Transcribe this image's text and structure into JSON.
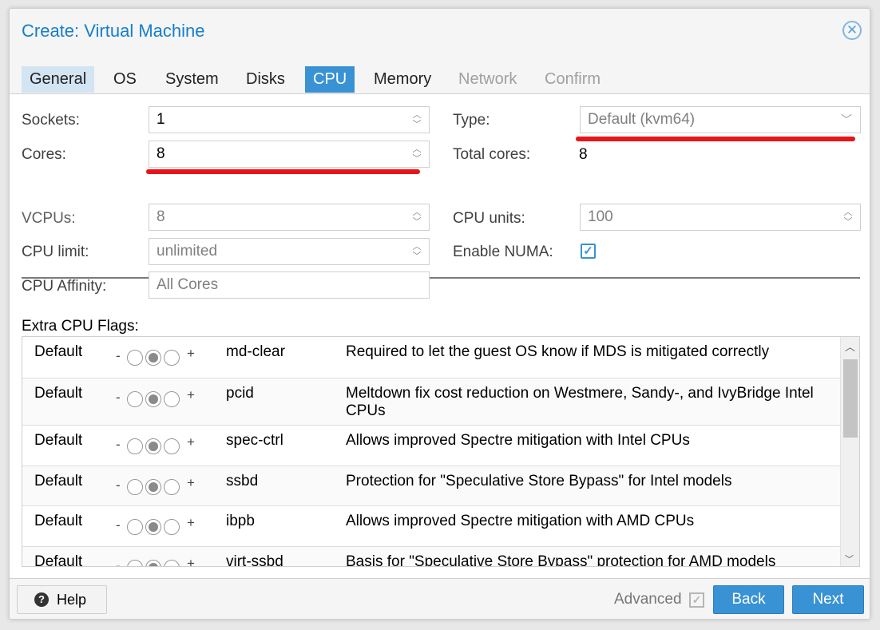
{
  "window": {
    "title": "Create: Virtual Machine"
  },
  "tabs": [
    {
      "label": "General",
      "state": "visited"
    },
    {
      "label": "OS",
      "state": "normal"
    },
    {
      "label": "System",
      "state": "normal"
    },
    {
      "label": "Disks",
      "state": "normal"
    },
    {
      "label": "CPU",
      "state": "active"
    },
    {
      "label": "Memory",
      "state": "normal"
    },
    {
      "label": "Network",
      "state": "disabled"
    },
    {
      "label": "Confirm",
      "state": "disabled"
    }
  ],
  "form": {
    "sockets": {
      "label": "Sockets:",
      "value": "1"
    },
    "cores": {
      "label": "Cores:",
      "value": "8"
    },
    "type": {
      "label": "Type:",
      "value": "Default (kvm64)"
    },
    "total_cores": {
      "label": "Total cores:",
      "value": "8"
    },
    "vcpus": {
      "label": "VCPUs:",
      "value": "8"
    },
    "cpu_units": {
      "label": "CPU units:",
      "value": "100"
    },
    "cpu_limit": {
      "label": "CPU limit:",
      "value": "unlimited"
    },
    "enable_numa": {
      "label": "Enable NUMA:",
      "checked": true
    },
    "cpu_affinity": {
      "label": "CPU Affinity:",
      "placeholder": "All Cores"
    }
  },
  "flags": {
    "label": "Extra CPU Flags:",
    "rows": [
      {
        "state": "Default",
        "minus": "-",
        "plus": "+",
        "flag": "md-clear",
        "description": "Required to let the guest OS know if MDS is mitigated correctly"
      },
      {
        "state": "Default",
        "minus": "-",
        "plus": "+",
        "flag": "pcid",
        "description": "Meltdown fix cost reduction on Westmere, Sandy-, and IvyBridge Intel CPUs"
      },
      {
        "state": "Default",
        "minus": "-",
        "plus": "+",
        "flag": "spec-ctrl",
        "description": "Allows improved Spectre mitigation with Intel CPUs"
      },
      {
        "state": "Default",
        "minus": "-",
        "plus": "+",
        "flag": "ssbd",
        "description": "Protection for \"Speculative Store Bypass\" for Intel models"
      },
      {
        "state": "Default",
        "minus": "-",
        "plus": "+",
        "flag": "ibpb",
        "description": "Allows improved Spectre mitigation with AMD CPUs"
      },
      {
        "state": "Default",
        "minus": "-",
        "plus": "+",
        "flag": "virt-ssbd",
        "description": "Basis for \"Speculative Store Bypass\" protection for AMD models"
      }
    ]
  },
  "footer": {
    "help": "Help",
    "advanced": "Advanced",
    "advanced_checked": true,
    "back": "Back",
    "next": "Next"
  },
  "colors": {
    "accent": "#3892d4",
    "title": "#157fcc",
    "highlight": "#e8141a"
  }
}
